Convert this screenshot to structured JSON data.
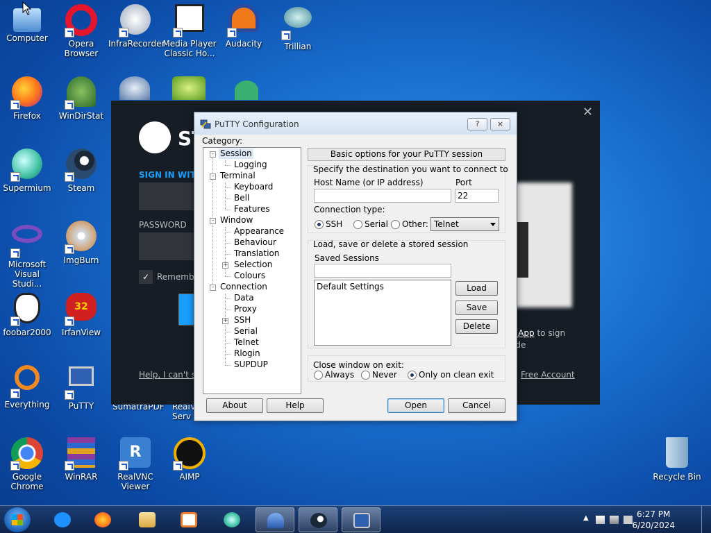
{
  "desktop_icons": [
    {
      "label": "Computer",
      "icon": "computer-icon",
      "color": "#5aa0e0"
    },
    {
      "label": "Opera Browser",
      "icon": "opera-icon",
      "color": "#e3162e"
    },
    {
      "label": "InfraRecorder",
      "icon": "infrarecorder-icon",
      "color": "#c9d3e0"
    },
    {
      "label": "Media Player Classic Ho...",
      "icon": "media-player-classic-icon",
      "color": "#f0f0f0"
    },
    {
      "label": "Audacity",
      "icon": "audacity-icon",
      "color": "#f07a1a"
    },
    {
      "label": "Trillian",
      "icon": "trillian-icon",
      "color": "#60a0b0"
    },
    {
      "label": "Firefox",
      "icon": "firefox-icon",
      "color": "#ff7a1a"
    },
    {
      "label": "WinDirStat",
      "icon": "windirstat-icon",
      "color": "#4a8a3a"
    },
    {
      "label": "Supermium",
      "icon": "supermium-icon",
      "color": "#3fc0a0"
    },
    {
      "label": "Steam",
      "icon": "steam-icon",
      "color": "#1b2838"
    },
    {
      "label": "Microsoft Visual Studi...",
      "icon": "visual-studio-icon",
      "color": "#7a4cc0"
    },
    {
      "label": "ImgBurn",
      "icon": "imgburn-icon",
      "color": "#d08030"
    },
    {
      "label": "foobar2000",
      "icon": "foobar2000-icon",
      "color": "#ffffff"
    },
    {
      "label": "IrfanView",
      "icon": "irfanview-icon",
      "color": "#d02020"
    },
    {
      "label": "Everything",
      "icon": "everything-icon",
      "color": "#f08a20"
    },
    {
      "label": "PuTTY",
      "icon": "putty-icon",
      "color": "#3060b0"
    },
    {
      "label": "Google Chrome",
      "icon": "chrome-icon",
      "color": "#4285f4"
    },
    {
      "label": "WinRAR",
      "icon": "winrar-icon",
      "color": "#8a3a9a"
    },
    {
      "label": "RealVNC Viewer",
      "icon": "realvnc-icon",
      "color": "#3a80d0"
    },
    {
      "label": "AIMP",
      "icon": "aimp-icon",
      "color": "#f0b000"
    },
    {
      "label": "Recycle Bin",
      "icon": "recycle-bin-icon",
      "color": "#9ab8d0"
    }
  ],
  "partially_hidden_labels": {
    "sumatra": "SumatraPDF",
    "realvnc_server": "RealV Serv"
  },
  "steam": {
    "title_fragment": "ST",
    "sign_in_label": "SIGN IN WITH",
    "password_label": "PASSWORD",
    "remember_label": "Remember",
    "help_link": "Help, I can't si",
    "qr_text_link": "e App",
    "qr_text_rest1": " to sign",
    "qr_text_rest2": "ode",
    "free_account_link": "Free Account"
  },
  "putty": {
    "title": "PuTTY Configuration",
    "help_btn": "?",
    "close_btn": "⨯",
    "category_label": "Category:",
    "tree": [
      {
        "label": "Session",
        "level": 0,
        "expander": "-",
        "selected": true
      },
      {
        "label": "Logging",
        "level": 1
      },
      {
        "label": "Terminal",
        "level": 0,
        "expander": "-"
      },
      {
        "label": "Keyboard",
        "level": 1
      },
      {
        "label": "Bell",
        "level": 1
      },
      {
        "label": "Features",
        "level": 1
      },
      {
        "label": "Window",
        "level": 0,
        "expander": "-"
      },
      {
        "label": "Appearance",
        "level": 1
      },
      {
        "label": "Behaviour",
        "level": 1
      },
      {
        "label": "Translation",
        "level": 1
      },
      {
        "label": "Selection",
        "level": 1,
        "expander": "+"
      },
      {
        "label": "Colours",
        "level": 1
      },
      {
        "label": "Connection",
        "level": 0,
        "expander": "-"
      },
      {
        "label": "Data",
        "level": 1
      },
      {
        "label": "Proxy",
        "level": 1
      },
      {
        "label": "SSH",
        "level": 1,
        "expander": "+"
      },
      {
        "label": "Serial",
        "level": 1
      },
      {
        "label": "Telnet",
        "level": 1
      },
      {
        "label": "Rlogin",
        "level": 1
      },
      {
        "label": "SUPDUP",
        "level": 1
      }
    ],
    "panel_header": "Basic options for your PuTTY session",
    "destination_label": "Specify the destination you want to connect to",
    "host_label": "Host Name (or IP address)",
    "host_value": "",
    "port_label": "Port",
    "port_value": "22",
    "conn_type_label": "Connection type:",
    "conn_types": [
      "SSH",
      "Serial",
      "Other:"
    ],
    "conn_selected": "SSH",
    "other_select_value": "Telnet",
    "session_group_label": "Load, save or delete a stored session",
    "saved_sessions_label": "Saved Sessions",
    "saved_session_input": "",
    "sessions_list": [
      "Default Settings"
    ],
    "load_btn": "Load",
    "save_btn": "Save",
    "delete_btn": "Delete",
    "close_exit_label": "Close window on exit:",
    "close_exit_options": [
      "Always",
      "Never",
      "Only on clean exit"
    ],
    "close_exit_selected": "Only on clean exit",
    "about_btn": "About",
    "help_bottom_btn": "Help",
    "open_btn": "Open",
    "cancel_btn": "Cancel"
  },
  "taskbar": {
    "items": [
      {
        "name": "internet-explorer",
        "icon": "internet-explorer-icon",
        "color": "#1e90ff"
      },
      {
        "name": "firefox",
        "icon": "firefox-icon",
        "color": "#ff7a1a"
      },
      {
        "name": "explorer",
        "icon": "folder-icon",
        "color": "#e8c060"
      },
      {
        "name": "media-player",
        "icon": "media-player-icon",
        "color": "#f08030"
      },
      {
        "name": "supermium",
        "icon": "supermium-icon",
        "color": "#3fc0a0"
      },
      {
        "name": "app-blue",
        "icon": "blue-app-icon",
        "color": "#3a70d0",
        "active": true
      },
      {
        "name": "steam",
        "icon": "steam-icon",
        "color": "#1b2838",
        "active": true
      },
      {
        "name": "putty",
        "icon": "putty-icon",
        "color": "#3060b0",
        "active": true
      }
    ],
    "time": "6:27 PM",
    "date": "6/20/2024"
  }
}
